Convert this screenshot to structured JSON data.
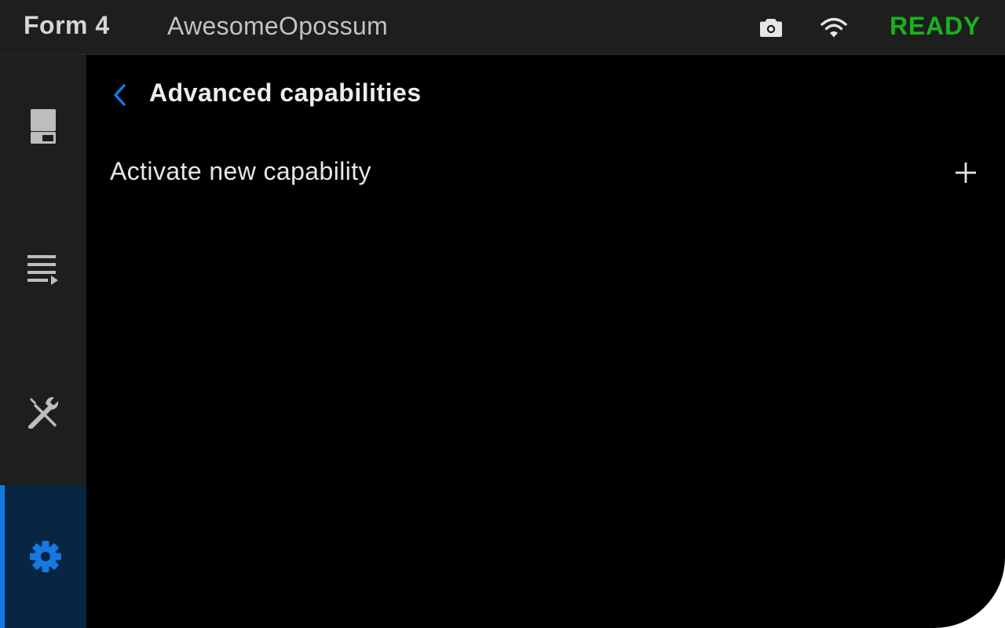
{
  "header": {
    "model": "Form 4",
    "printer_name": "AwesomeOpossum",
    "status": "READY",
    "icons": {
      "camera": "camera-icon",
      "wifi": "wifi-icon"
    }
  },
  "sidebar": {
    "items": [
      {
        "id": "printer",
        "icon": "printer-icon",
        "active": false
      },
      {
        "id": "queue",
        "icon": "queue-icon",
        "active": false
      },
      {
        "id": "tools",
        "icon": "tools-icon",
        "active": false
      },
      {
        "id": "settings",
        "icon": "gear-icon",
        "active": true
      }
    ]
  },
  "page": {
    "title": "Advanced capabilities",
    "back_icon": "chevron-left-icon",
    "rows": [
      {
        "label": "Activate new capability",
        "icon": "plus-icon"
      }
    ]
  },
  "colors": {
    "accent": "#1479e0",
    "status_ready": "#18b31e",
    "background": "#000000",
    "panel": "#1e1e1e",
    "active_nav": "#082544"
  }
}
